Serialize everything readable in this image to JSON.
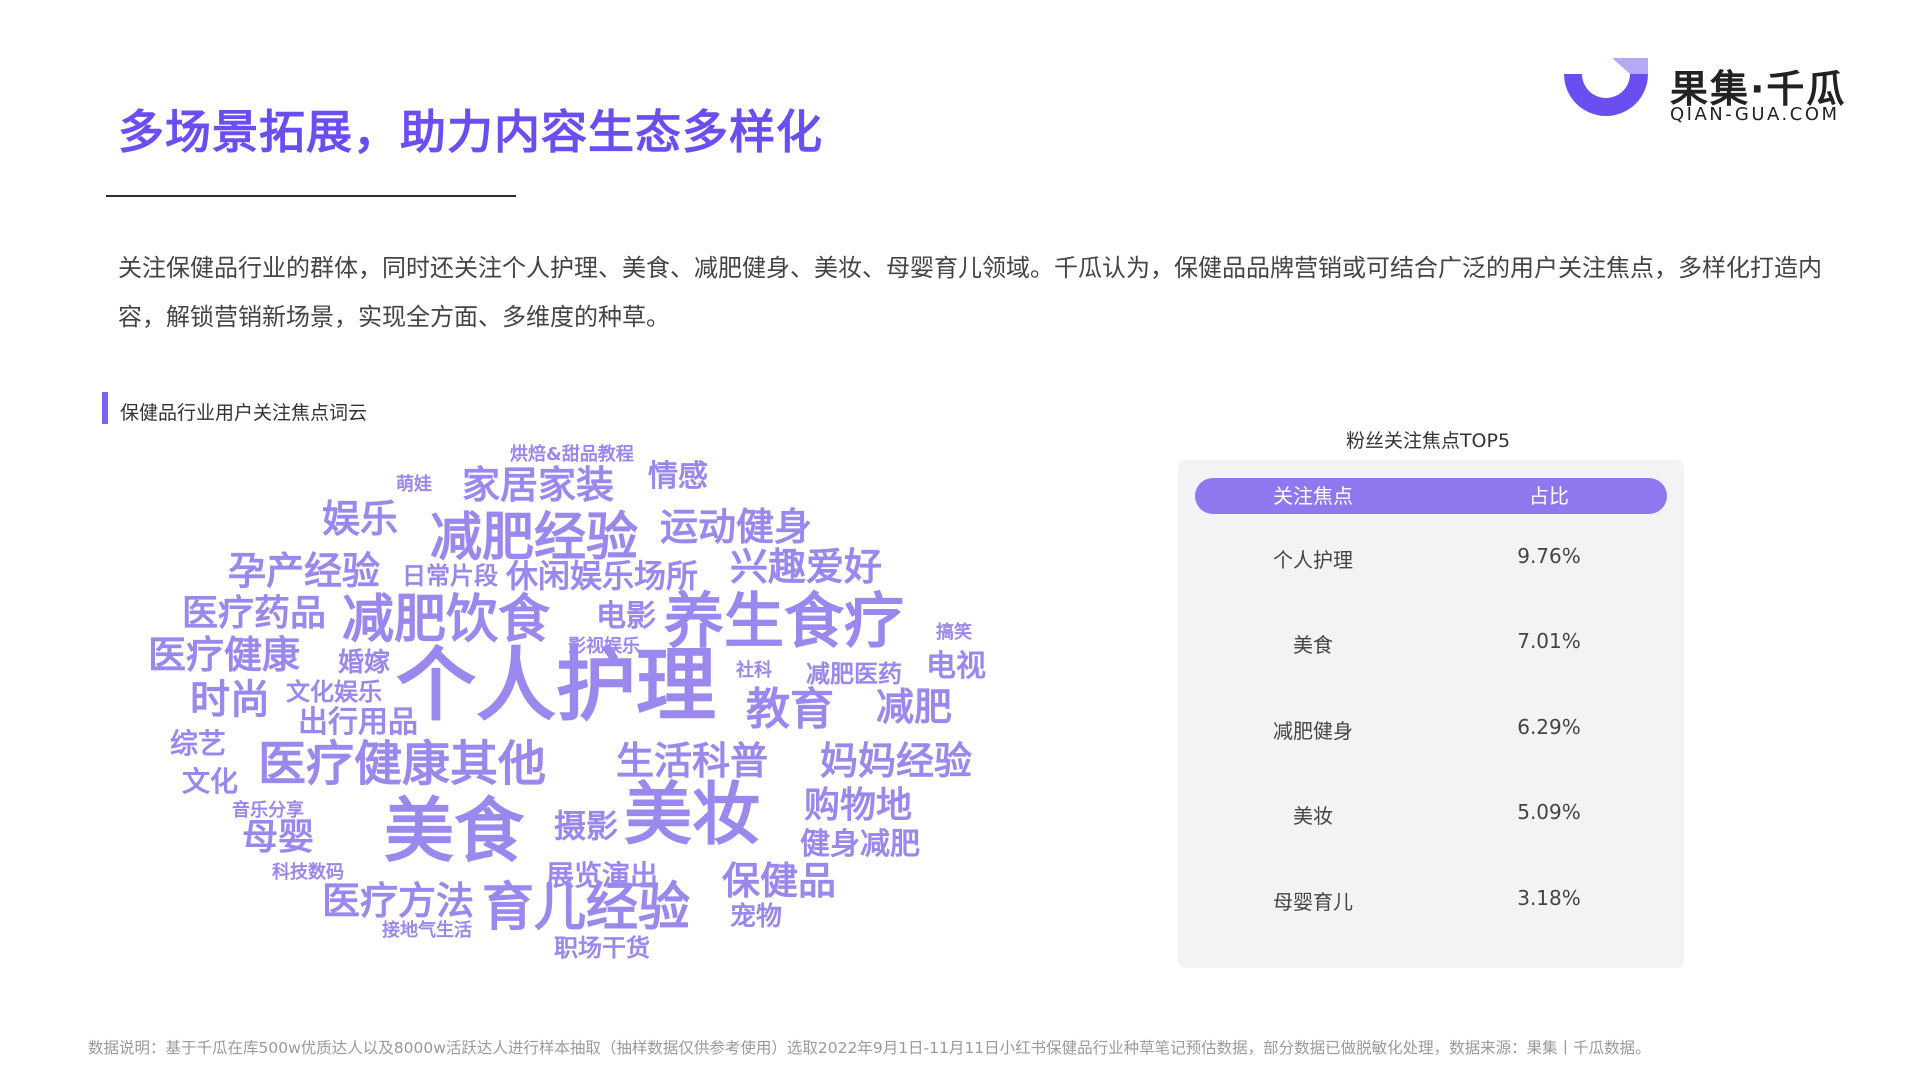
{
  "header": {
    "title": "多场景拓展，助力内容生态多样化",
    "logo_cn": "果集·千瓜",
    "logo_en": "QIAN-GUA.COM"
  },
  "intro": {
    "text": "关注保健品行业的群体，同时还关注个人护理、美食、减肥健身、美妆、母婴育儿领域。千瓜认为，保健品品牌营销或可结合广泛的用户关注焦点，多样化打造内容，解锁营销新场景，实现全方面、多维度的种草。"
  },
  "wordcloud": {
    "label": "保健品行业用户关注焦点词云",
    "words": [
      "烘焙&甜品教程",
      "萌娃",
      "家居家装",
      "情感",
      "娱乐",
      "减肥经验",
      "运动健身",
      "孕产经验",
      "日常片段",
      "休闲娱乐场所",
      "兴趣爱好",
      "医疗药品",
      "减肥饮食",
      "电影",
      "养生食疗",
      "搞笑",
      "医疗健康",
      "影视娱乐",
      "婚嫁",
      "社科",
      "减肥医药",
      "电视",
      "时尚",
      "文化娱乐",
      "个人护理",
      "教育",
      "减肥",
      "出行用品",
      "综艺",
      "医疗健康其他",
      "生活科普",
      "妈妈经验",
      "文化",
      "音乐分享",
      "美食",
      "美妆",
      "购物地",
      "摄影",
      "母婴",
      "健身减肥",
      "科技数码",
      "展览演出",
      "保健品",
      "医疗方法",
      "育儿经验",
      "宠物",
      "接地气生活",
      "职场干货"
    ]
  },
  "top5": {
    "caption": "粉丝关注焦点TOP5",
    "headers": {
      "focus": "关注焦点",
      "ratio": "占比"
    },
    "rows": [
      {
        "focus": "个人护理",
        "ratio": "9.76%"
      },
      {
        "focus": "美食",
        "ratio": "7.01%"
      },
      {
        "focus": "减肥健身",
        "ratio": "6.29%"
      },
      {
        "focus": "美妆",
        "ratio": "5.09%"
      },
      {
        "focus": "母婴育儿",
        "ratio": "3.18%"
      }
    ]
  },
  "footnote": "数据说明：基于千瓜在库500w优质达人以及8000w活跃达人进行样本抽取（抽样数据仅供参考使用）选取2022年9月1日-11月11日小红书保健品行业种草笔记预估数据，部分数据已做脱敏化处理，数据来源：果集丨千瓜数据。",
  "colors": {
    "accent": "#6b4ef2",
    "cloud": "#9b88ee",
    "table_header": "#8f78ef",
    "panel": "#f3f3f5"
  }
}
